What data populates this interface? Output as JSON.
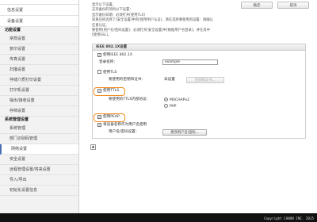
{
  "sidebar": {
    "top_items": [
      "信息设置",
      "设备设置"
    ],
    "group1_title": "功能设置",
    "group1_items": [
      "常规设置",
      "复印设置",
      "传真设置",
      "扫描设置",
      "存储介质打印设置",
      "打印机设置",
      "输出/接收设置",
      "存档设置"
    ],
    "group2_title": "系统管理设置",
    "group2_items": [
      "系统管理",
      "部门识别码管理",
      "网络设置",
      "安全设置",
      "远程管理设置/将来设置",
      "导入/导出",
      "初始化设置信息"
    ]
  },
  "header": {
    "button1": "确定",
    "button2": "取消"
  },
  "info": {
    "lines": [
      "显示以下设置。",
      "支持备份的项目以下设置：",
      "显示备份日期：必须打开[使用TLS]",
      "如果已经选择了[安全设置]中的[使用用户认证]，请在选择要使用的设置：请确认",
      "任意认证。",
      "要使用[用户名/密码设置]：必须打开[安全设置]中[根据用户名登录]，并在其中",
      "[使用SSL]。"
    ]
  },
  "panel": {
    "title": "IEEE 802.1X设置",
    "use_ieee": "使用IEEE 802.1X",
    "login_name_label": "登录名称：",
    "login_name_value": "example",
    "use_tls": "使用TLS",
    "key_cert_label": "要使用的密钥和证书：",
    "key_cert_value": "未设置",
    "key_cert_button": "密钥和证书...",
    "use_ttls": "使用TTLS",
    "ttls_protocol_label": "要使用的TTLS内部协议：",
    "ttls_options": [
      "MSCHAPv2",
      "PAP"
    ],
    "use_peap": "使用PEAP",
    "use_device_user": "将设备名称作为用户名使用",
    "user_pw_label": "用户名/密码设置：",
    "user_pw_button": "更改用户名/密码..."
  },
  "up_arrow": "▲",
  "footer": {
    "copyright": "Copyright CANON INC. 2015"
  }
}
